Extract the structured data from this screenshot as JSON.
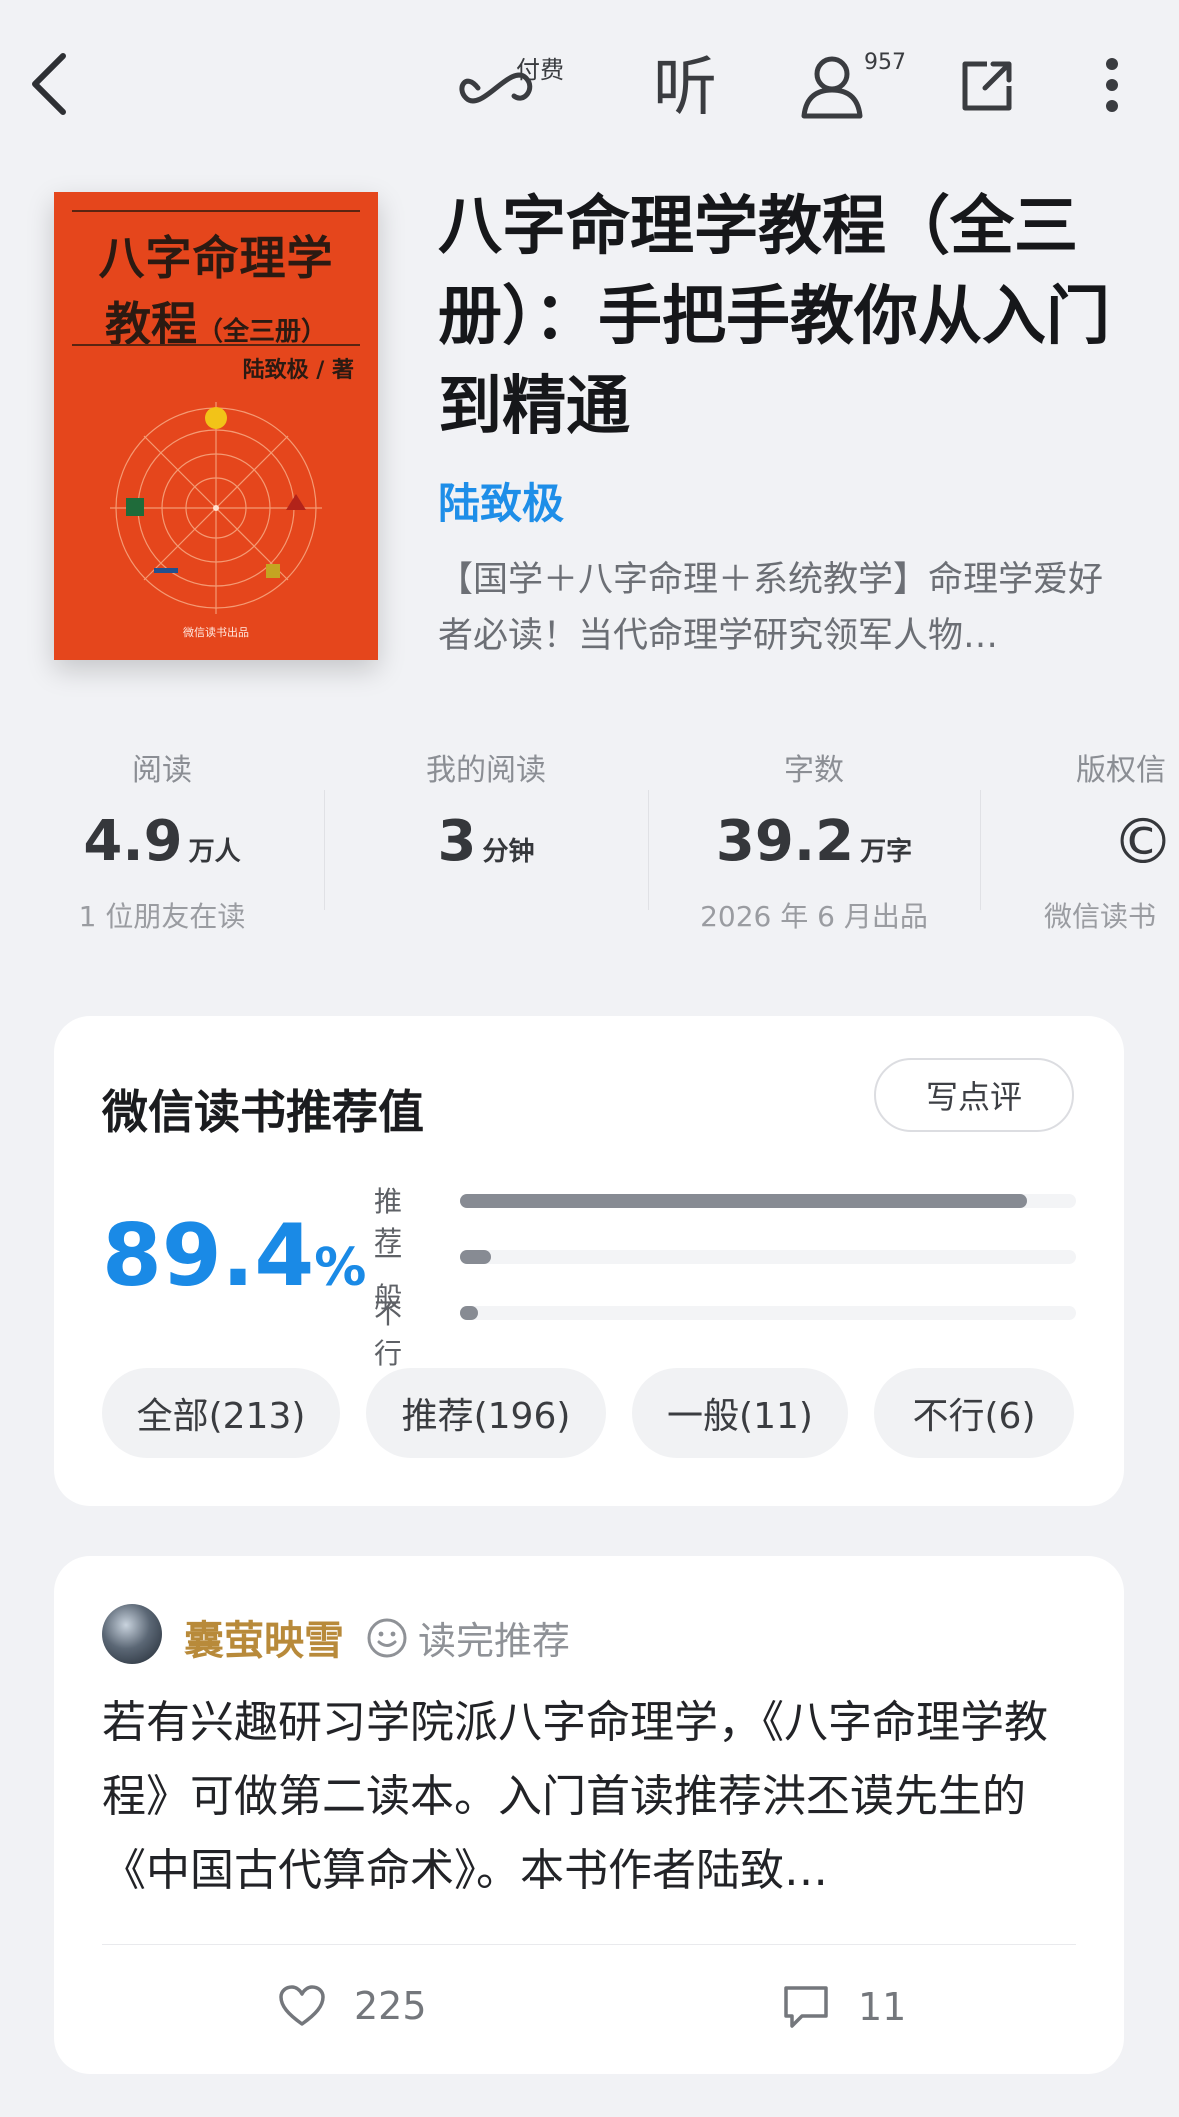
{
  "topbar": {
    "paid_label": "付费",
    "listen_label": "听",
    "readers_count": "957"
  },
  "book": {
    "cover": {
      "title_line1": "八字命理学",
      "title_line2": "教程",
      "title_volume": "（全三册）",
      "author_line": "陆致极 / 著",
      "publisher": "微信读书出品",
      "color": "#e5461c"
    },
    "title": "八字命理学教程（全三册）：手把手教你从入门到精通",
    "author": "陆致极",
    "description": "【国学＋八字命理＋系统教学】命理学爱好者必读！当代命理学研究领军人物…"
  },
  "stats": [
    {
      "label": "阅读",
      "value": "4.9",
      "unit": "万人",
      "sub": "1 位朋友在读"
    },
    {
      "label": "我的阅读",
      "value": "3",
      "unit": "分钟",
      "sub": ""
    },
    {
      "label": "字数",
      "value": "39.2",
      "unit": "万字",
      "sub": "2026 年 6 月出品"
    },
    {
      "label": "版权信",
      "value": "©",
      "unit": "",
      "sub": "微信读书"
    }
  ],
  "recommend": {
    "title": "微信读书推荐值",
    "write_button": "写点评",
    "score": "89.4",
    "score_unit": "%",
    "bars": [
      {
        "label": "推荐",
        "fraction": 0.92
      },
      {
        "label": "一般",
        "fraction": 0.05
      },
      {
        "label": "不行",
        "fraction": 0.03
      }
    ],
    "chips": [
      "全部(213)",
      "推荐(196)",
      "一般(11)",
      "不行(6)"
    ],
    "accent": "#1a8ae6"
  },
  "review": {
    "user": "囊萤映雪",
    "tag": "读完推荐",
    "text": "若有兴趣研习学院派八字命理学，《八字命理学教程》可做第二读本。入门首读推荐洪丕谟先生的《中国古代算命术》。本书作者陆致…",
    "likes": "225",
    "comments": "11"
  }
}
